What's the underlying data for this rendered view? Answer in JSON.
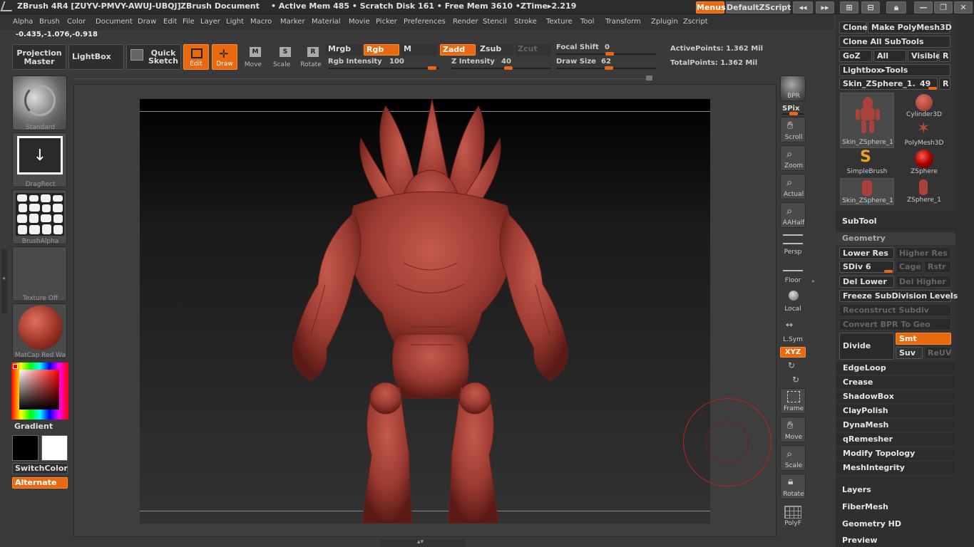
{
  "title": {
    "app": "ZBrush 4R4 [ZUYV-PMVY-AWUJ-UBQJ]",
    "document": "ZBrush Document",
    "stats": "• Active Mem 485 • Scratch Disk 161 • Free Mem 3610 •ZTime▸2.219",
    "menus_button": "Menus",
    "script_button": "DefaultZScript"
  },
  "menubar": [
    "Alpha",
    "Brush",
    "Color",
    "Document",
    "Draw",
    "Edit",
    "File",
    "Layer",
    "Light",
    "Macro",
    "Marker",
    "Material",
    "Movie",
    "Picker",
    "Preferences",
    "Render",
    "Stencil",
    "Stroke",
    "Texture",
    "Tool",
    "Transform",
    "Zplugin",
    "Zscript"
  ],
  "coords": "-0.435,-1.076,-0.918",
  "toolbar": {
    "projection_master": "Projection Master",
    "lightbox": "LightBox",
    "quick_sketch": "Quick Sketch",
    "edit": "Edit",
    "draw": "Draw",
    "move": "Move",
    "scale": "Scale",
    "rotate": "Rotate",
    "mrgb": "Mrgb",
    "rgb": "Rgb",
    "m": "M",
    "zadd": "Zadd",
    "zsub": "Zsub",
    "zcut": "Zcut",
    "rgb_intensity_label": "Rgb Intensity",
    "rgb_intensity_value": "100",
    "z_intensity_label": "Z Intensity",
    "z_intensity_value": "40",
    "focal_shift_label": "Focal Shift",
    "focal_shift_value": "0",
    "draw_size_label": "Draw Size",
    "draw_size_value": "62",
    "active_points": "ActivePoints: 1.362 Mil",
    "total_points": "TotalPoints: 1.362 Mil"
  },
  "leftshelf": {
    "brush": "Standard",
    "stroke": "DragRect",
    "alpha": "BrushAlpha",
    "texture": "Texture Off",
    "material": "MatCap Red Wa",
    "gradient": "Gradient",
    "switch_color": "SwitchColor",
    "alternate": "Alternate"
  },
  "rightshelf": [
    "BPR",
    "SPix",
    "Scroll",
    "Zoom",
    "Actual",
    "AAHalf",
    "Persp",
    "Floor",
    "Local",
    "L.Sym",
    "XYZ",
    "Frame",
    "Move",
    "Scale",
    "Rotate",
    "PolyF"
  ],
  "rightpanel": {
    "clone": "Clone",
    "make_polymesh": "Make PolyMesh3D",
    "clone_all": "Clone All SubTools",
    "goz": "GoZ",
    "all": "All",
    "visible": "Visible",
    "r": "R",
    "lightbox_tools": "Lightbox▸Tools",
    "current_tool": "Skin_ZSphere_1.",
    "current_tool_value": "49",
    "tools": [
      "Skin_ZSphere_1",
      "Cylinder3D",
      "SimpleBrush",
      "PolyMesh3D",
      "ZSphere",
      "Skin_ZSphere_1",
      "ZSphere_1"
    ],
    "subtool": "SubTool",
    "geometry": "Geometry",
    "lower_res": "Lower Res",
    "higher_res": "Higher Res",
    "sdiv_label": "SDiv",
    "sdiv_value": "6",
    "cage": "Cage",
    "rstr": "Rstr",
    "del_lower": "Del Lower",
    "del_higher": "Del Higher",
    "freeze": "Freeze SubDivision Levels",
    "reconstruct": "Reconstruct Subdiv",
    "convert_bpr": "Convert BPR To Geo",
    "divide": "Divide",
    "smt": "Smt",
    "suv": "Suv",
    "reuv": "ReUV",
    "edgeloop": "EdgeLoop",
    "crease": "Crease",
    "shadowbox": "ShadowBox",
    "claypolish": "ClayPolish",
    "dynamesh": "DynaMesh",
    "qremesher": "qRemesher",
    "modify_topology": "Modify Topology",
    "meshintegrity": "MeshIntegrity",
    "layers": "Layers",
    "fibermesh": "FiberMesh",
    "geometry_hd": "Geometry HD",
    "preview": "Preview"
  },
  "colors": {
    "accent": "#e8690f",
    "model": "#a8423a"
  }
}
